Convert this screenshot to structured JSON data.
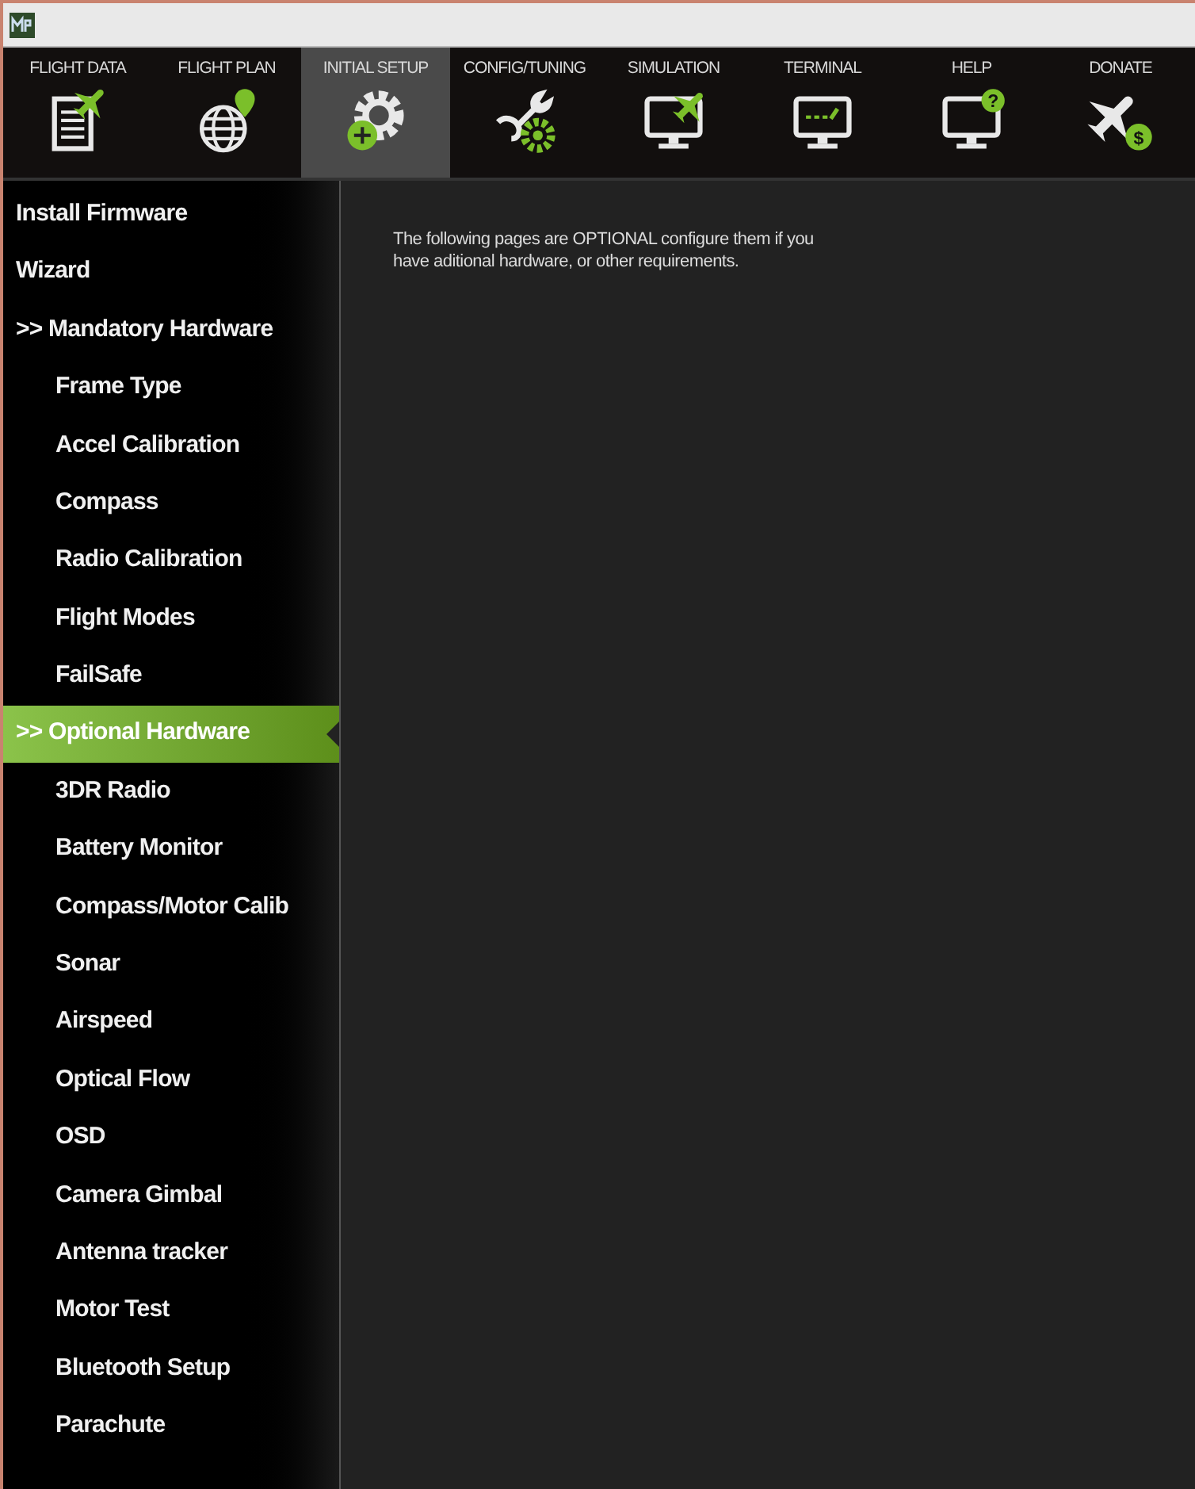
{
  "toolbar": {
    "tabs": [
      {
        "label": "FLIGHT DATA",
        "selected": false
      },
      {
        "label": "FLIGHT PLAN",
        "selected": false
      },
      {
        "label": "INITIAL SETUP",
        "selected": true
      },
      {
        "label": "CONFIG/TUNING",
        "selected": false
      },
      {
        "label": "SIMULATION",
        "selected": false
      },
      {
        "label": "TERMINAL",
        "selected": false
      },
      {
        "label": "HELP",
        "selected": false,
        "badge": "?"
      },
      {
        "label": "DONATE",
        "selected": false,
        "badge": "$"
      }
    ]
  },
  "sidebar": {
    "items": [
      {
        "label": "Install Firmware",
        "selected": false
      },
      {
        "label": "Wizard",
        "selected": false
      },
      {
        "label": ">> Mandatory Hardware",
        "selected": false,
        "children": [
          {
            "label": "Frame Type",
            "selected": false
          },
          {
            "label": "Accel Calibration",
            "selected": false
          },
          {
            "label": "Compass",
            "selected": false
          },
          {
            "label": "Radio Calibration",
            "selected": false
          },
          {
            "label": "Flight Modes",
            "selected": false
          },
          {
            "label": "FailSafe",
            "selected": false
          }
        ]
      },
      {
        "label": ">> Optional Hardware",
        "selected": true,
        "children": [
          {
            "label": "3DR Radio",
            "selected": false
          },
          {
            "label": "Battery Monitor",
            "selected": false
          },
          {
            "label": "Compass/Motor Calib",
            "selected": false
          },
          {
            "label": "Sonar",
            "selected": false
          },
          {
            "label": "Airspeed",
            "selected": false
          },
          {
            "label": "Optical Flow",
            "selected": false
          },
          {
            "label": "OSD",
            "selected": false
          },
          {
            "label": "Camera Gimbal",
            "selected": false
          },
          {
            "label": "Antenna tracker",
            "selected": false
          },
          {
            "label": "Motor Test",
            "selected": false
          },
          {
            "label": "Bluetooth Setup",
            "selected": false
          },
          {
            "label": "Parachute",
            "selected": false
          }
        ]
      }
    ]
  },
  "content": {
    "message": "The following pages are OPTIONAL configure them if you have aditional hardware, or other requirements."
  }
}
